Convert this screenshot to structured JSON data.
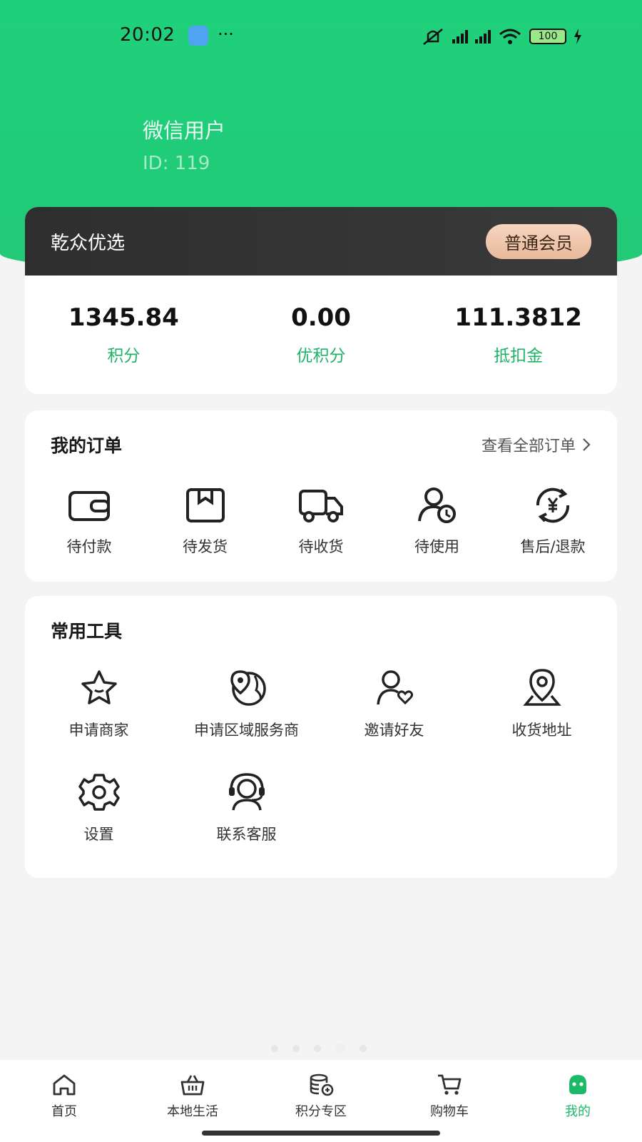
{
  "status_bar": {
    "time": "20:02",
    "dots": "···",
    "battery": "100"
  },
  "user": {
    "name": "微信用户",
    "id": "ID:  119"
  },
  "member": {
    "brand": "乾众优选",
    "level": "普通会员"
  },
  "stats": [
    {
      "value": "1345.84",
      "label": "积分"
    },
    {
      "value": "0.00",
      "label": "优积分"
    },
    {
      "value": "111.3812",
      "label": "抵扣金"
    }
  ],
  "orders": {
    "title": "我的订单",
    "view_all": "查看全部订单",
    "items": [
      {
        "label": "待付款",
        "icon": "wallet-icon"
      },
      {
        "label": "待发货",
        "icon": "box-icon"
      },
      {
        "label": "待收货",
        "icon": "truck-icon"
      },
      {
        "label": "待使用",
        "icon": "user-clock-icon"
      },
      {
        "label": "售后/退款",
        "icon": "refund-icon"
      }
    ]
  },
  "tools": {
    "title": "常用工具",
    "items": [
      {
        "label": "申请商家",
        "icon": "star-icon"
      },
      {
        "label": "申请区域服务商",
        "icon": "globe-pin-icon"
      },
      {
        "label": "邀请好友",
        "icon": "user-heart-icon"
      },
      {
        "label": "收货地址",
        "icon": "location-icon"
      },
      {
        "label": "设置",
        "icon": "gear-icon"
      },
      {
        "label": "联系客服",
        "icon": "headset-icon"
      }
    ]
  },
  "tabbar": [
    {
      "label": "首页",
      "icon": "home-icon"
    },
    {
      "label": "本地生活",
      "icon": "basket-icon"
    },
    {
      "label": "积分专区",
      "icon": "coins-icon"
    },
    {
      "label": "购物车",
      "icon": "cart-icon"
    },
    {
      "label": "我的",
      "icon": "profile-icon",
      "active": true
    }
  ],
  "colors": {
    "header_green": "#22c978",
    "accent_green": "#1bb968",
    "member_dark": "#2e2e2e",
    "member_badge": "#e9b99c"
  }
}
